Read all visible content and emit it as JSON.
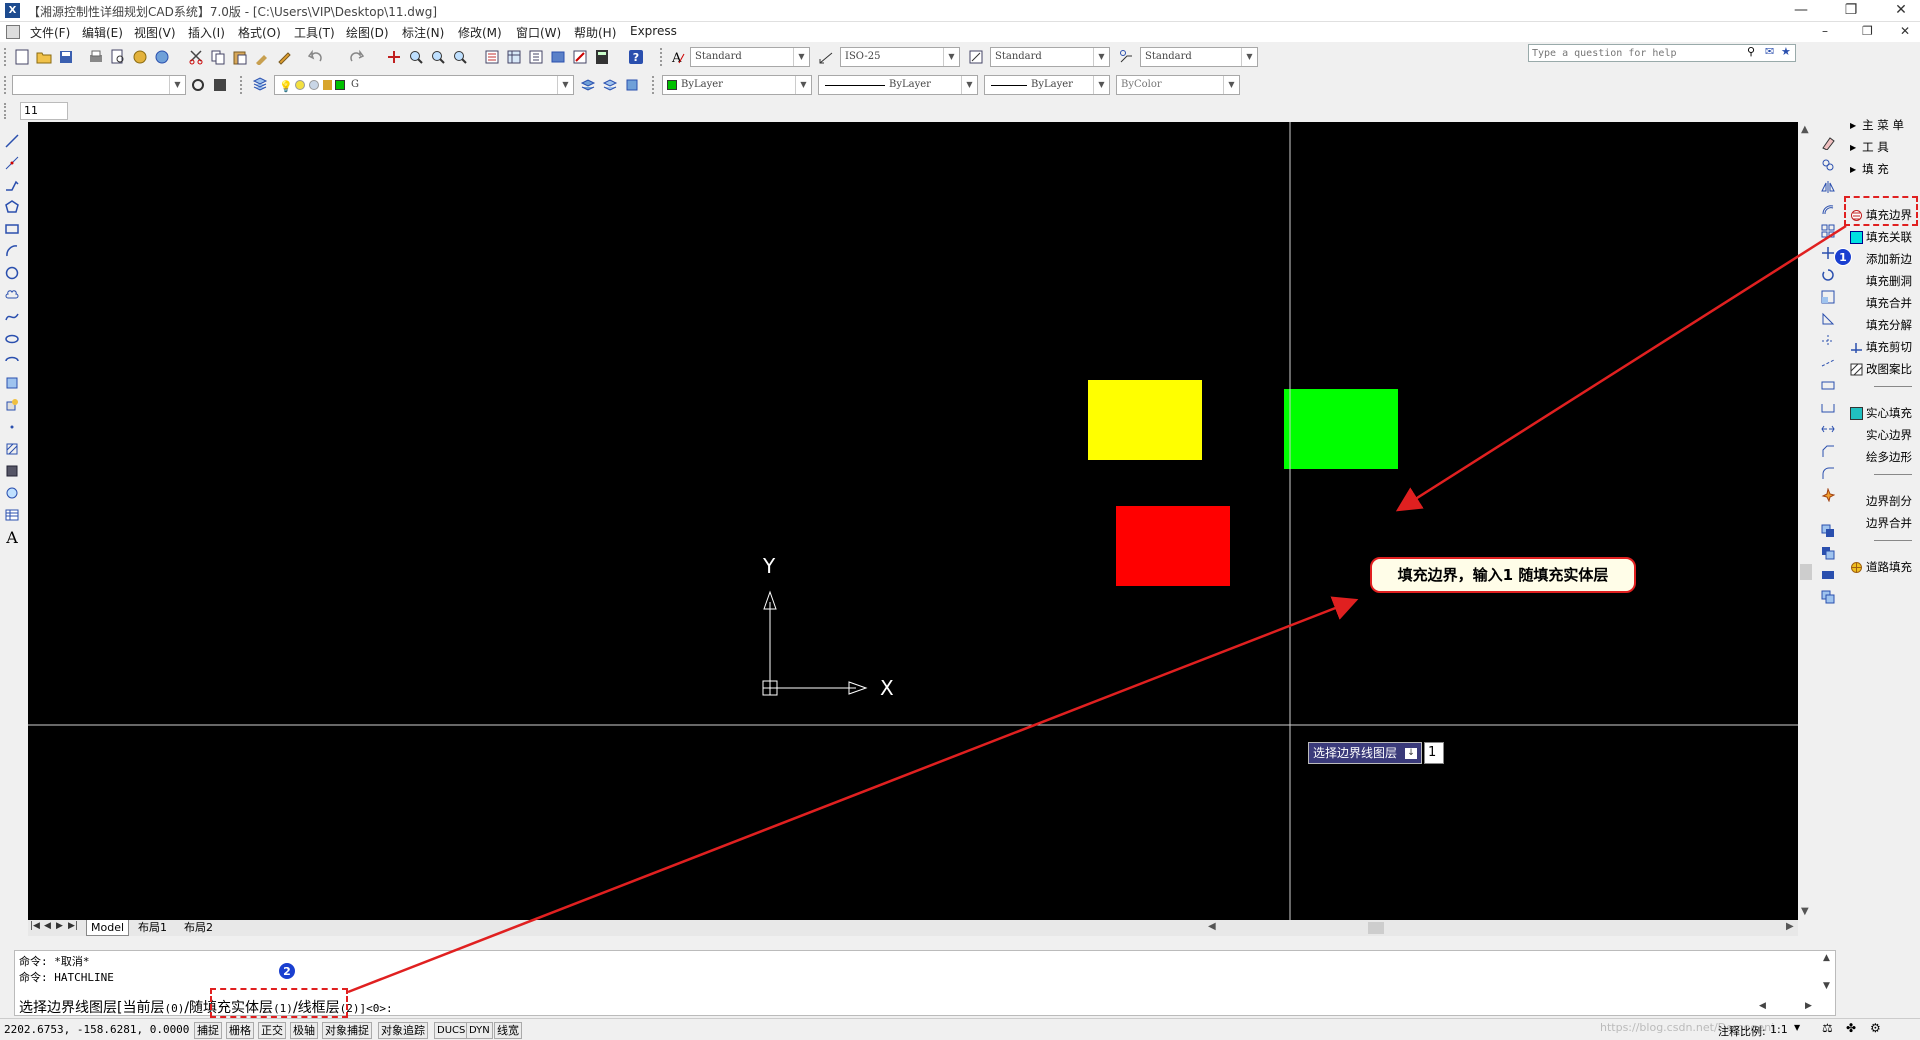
{
  "window": {
    "title": "【湘源控制性详细规划CAD系统】7.0版 - [C:\\Users\\VIP\\Desktop\\11.dwg]",
    "app_icon": "X",
    "help_placeholder": "Type a question for help"
  },
  "menu": [
    "文件(F)",
    "编辑(E)",
    "视图(V)",
    "插入(I)",
    "格式(O)",
    "工具(T)",
    "绘图(D)",
    "标注(N)",
    "修改(M)",
    "窗口(W)",
    "帮助(H)",
    "Express"
  ],
  "toolbar": {
    "text_style": "Standard",
    "dim_style": "ISO-25",
    "table_style": "Standard",
    "mleader_style": "Standard",
    "layer_name": "G",
    "color": "ByLayer",
    "linetype": "ByLayer",
    "lineweight": "ByLayer",
    "plotstyle": "ByColor",
    "small_input": "11"
  },
  "colors": {
    "yellow": "#ffff00",
    "green": "#00ff00",
    "red": "#ff0000",
    "accent": "#e02020",
    "badge": "#1a3fd0"
  },
  "canvas": {
    "ucs_x": "X",
    "ucs_y": "Y",
    "dyn_prompt": "选择边界线图层",
    "dyn_value": "1"
  },
  "callout": "填充边界，输入1 随填充实体层",
  "badges": [
    "1",
    "2"
  ],
  "right_panel": {
    "groups": [
      "主 菜 单",
      "工    具",
      "填    充"
    ],
    "items": [
      "填充边界",
      "填充关联",
      "添加新边",
      "填充删洞",
      "填充合并",
      "填充分解",
      "填充剪切",
      "改图案比",
      "实心填充",
      "实心边界",
      "绘多边形",
      "边界剖分",
      "边界合并",
      "道路填充"
    ]
  },
  "tabs": [
    "Model",
    "布局1",
    "布局2"
  ],
  "command": {
    "line1": "命令: *取消*",
    "line2": "命令: HATCHLINE",
    "prompt_a": "选择边界线图层[当前层",
    "prompt_a_key": "(0)",
    "prompt_b": "/随填充实体层",
    "prompt_b_key": "(1)",
    "prompt_c": "/线框层",
    "prompt_c_key": "(2)",
    "prompt_d": "]<0>:"
  },
  "status": {
    "coords": "2202.6753,  -158.6281, 0.0000",
    "buttons": [
      "捕捉",
      "栅格",
      "正交",
      "极轴",
      "对象捕捉",
      "对象追踪",
      "DUCS",
      "DYN",
      "线宽"
    ],
    "scale_label": "注释比例:",
    "scale_value": "1:1",
    "watermark": "https://blog.csdn.net/Demogeni"
  }
}
